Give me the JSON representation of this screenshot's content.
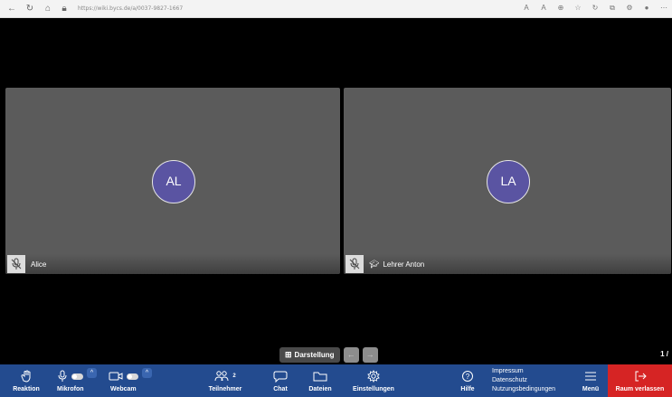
{
  "browser": {
    "url": "https://wiki.bycs.de/a/0037-9827-1667",
    "nav_icons": [
      "back-icon",
      "refresh-icon",
      "home-icon",
      "lock-icon"
    ]
  },
  "tiles": [
    {
      "initials": "AL",
      "name": "Alice",
      "avatar_color": "#5a54a2",
      "muted": true,
      "moderator": false
    },
    {
      "initials": "LA",
      "name": "Lehrer Anton",
      "avatar_color": "#5a54a2",
      "muted": true,
      "moderator": true
    }
  ],
  "layout": {
    "label": "Darstellung",
    "page": "1 /"
  },
  "toolbar": {
    "reaction": "Reaktion",
    "mic": "Mikrofon",
    "webcam": "Webcam",
    "participants": "Teilnehmer",
    "participants_count": "2",
    "chat": "Chat",
    "files": "Dateien",
    "settings": "Einstellungen",
    "help": "Hilfe",
    "imprint": "Impressum",
    "privacy": "Datenschutz",
    "terms": "Nutzungsbedingungen",
    "menu": "Menü",
    "leave": "Raum verlassen",
    "bar_color": "#234b8f",
    "leave_color": "#d62424"
  }
}
